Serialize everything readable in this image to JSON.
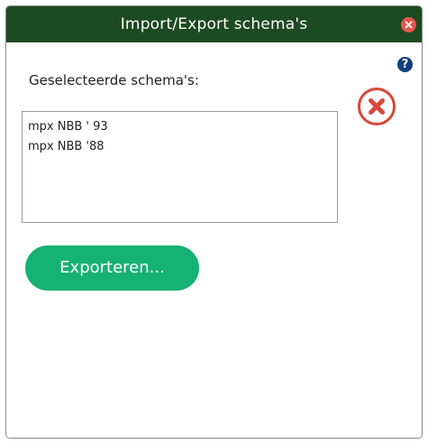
{
  "window": {
    "title": "Import/Export schema's"
  },
  "help": {
    "label": "?"
  },
  "selection": {
    "label": "Geselecteerde schema's:",
    "items": [
      "mpx NBB ' 93",
      "mpx NBB '88"
    ]
  },
  "actions": {
    "export_label": "Exporteren..."
  },
  "colors": {
    "titlebar": "#1c4a22",
    "close_dot": "#e2574c",
    "help": "#0f3f7e",
    "big_close": "#d9473b",
    "export_button": "#16b174"
  },
  "icons": {
    "window_close": "close-icon",
    "help": "help-icon",
    "clear_selection": "remove-icon"
  }
}
